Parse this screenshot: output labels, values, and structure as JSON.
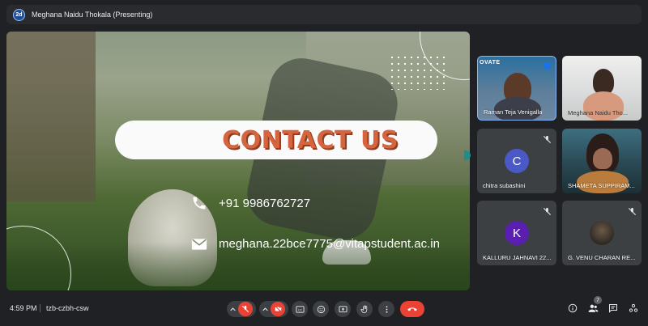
{
  "header": {
    "presenter_initials": "2d",
    "presenter_label": "Meghana Naidu Thokala (Presenting)"
  },
  "slide": {
    "title": "CONTACT US",
    "phone": "+91 9986762727",
    "email": "meghana.22bce7775@vitapstudent.ac.in",
    "colors": {
      "title": "#d5643f",
      "title_shadow": "#8a3f24",
      "pill": "#fafafa"
    }
  },
  "participants": [
    {
      "name": "Raman Teja Venigalla",
      "badge": "OVATE",
      "video": true,
      "speaking": true,
      "muted": false
    },
    {
      "name": "Meghana Naidu Tho...",
      "video": true,
      "muted": false
    },
    {
      "name": "chitra subashini",
      "initial": "C",
      "avatar_color": "#4b59c6",
      "muted": true
    },
    {
      "name": "SHAMETA SUPPIRAM...",
      "video": true,
      "muted": false
    },
    {
      "name": "KALLURU JAHNAVI 22...",
      "initial": "K",
      "avatar_color": "#5a1fb0",
      "muted": true
    },
    {
      "name": "G. VENU CHARAN RE...",
      "video": false,
      "muted": true
    }
  ],
  "toolbar": {
    "time": "4:59 PM",
    "meeting_code": "tzb-czbh-csw",
    "participant_count": "7",
    "controls": [
      "mic-off",
      "camera-off",
      "captions",
      "emoji",
      "present",
      "raise-hand",
      "more",
      "end-call"
    ],
    "right_controls": [
      "info",
      "people",
      "chat",
      "activities"
    ]
  }
}
